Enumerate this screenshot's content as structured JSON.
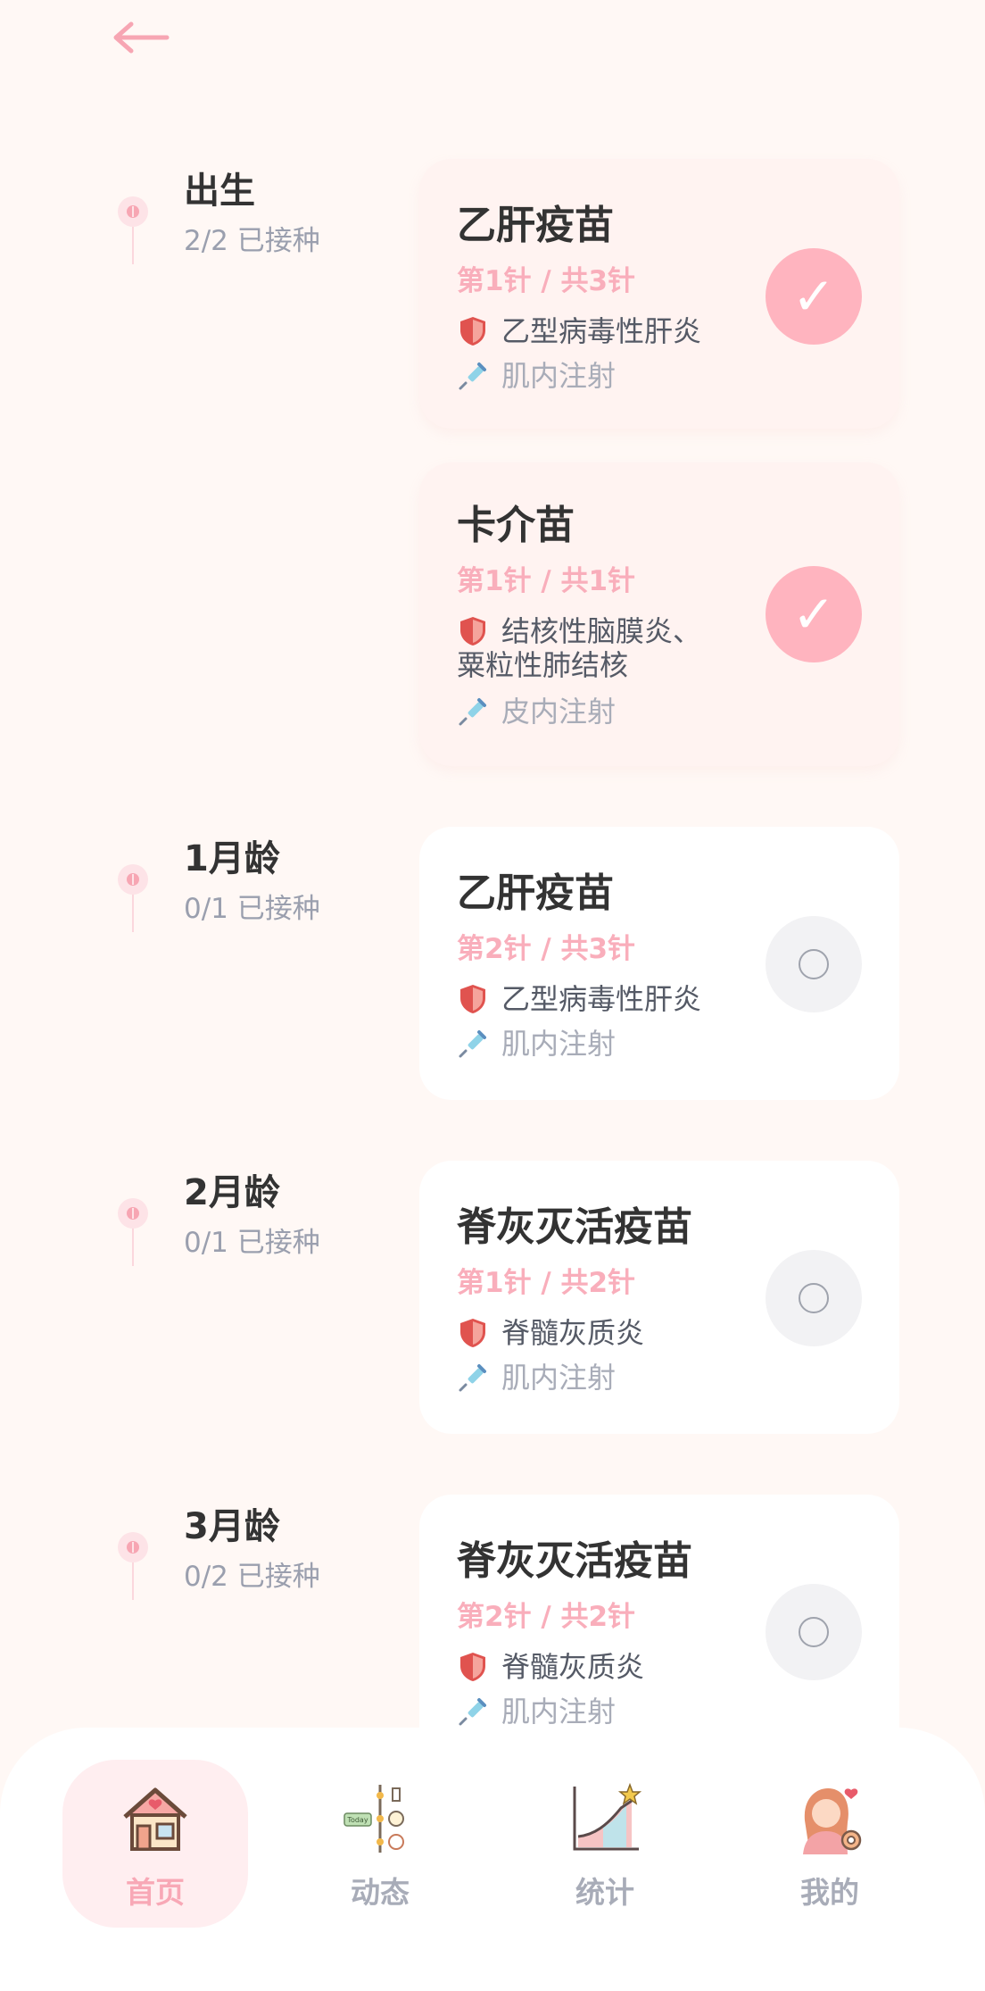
{
  "groups": [
    {
      "age": "出生",
      "progress": "2/2 已接种",
      "vaccines": [
        {
          "name": "乙肝疫苗",
          "dose": "第1针 / 共3针",
          "disease": "乙型病毒性肝炎",
          "route": "肌内注射",
          "done": true
        },
        {
          "name": "卡介苗",
          "dose": "第1针 / 共1针",
          "disease_line1": "结核性脑膜炎、",
          "disease_line2": "粟粒性肺结核",
          "route": "皮内注射",
          "done": true
        }
      ]
    },
    {
      "age": "1月龄",
      "progress": "0/1 已接种",
      "vaccines": [
        {
          "name": "乙肝疫苗",
          "dose": "第2针 / 共3针",
          "disease": "乙型病毒性肝炎",
          "route": "肌内注射",
          "done": false
        }
      ]
    },
    {
      "age": "2月龄",
      "progress": "0/1 已接种",
      "vaccines": [
        {
          "name": "脊灰灭活疫苗",
          "dose": "第1针 / 共2针",
          "disease": "脊髓灰质炎",
          "route": "肌内注射",
          "done": false
        }
      ]
    },
    {
      "age": "3月龄",
      "progress": "0/2 已接种",
      "vaccines": [
        {
          "name": "脊灰灭活疫苗",
          "dose": "第2针 / 共2针",
          "disease": "脊髓灰质炎",
          "route": "肌内注射",
          "done": false
        }
      ]
    }
  ],
  "status_glyphs": {
    "checked": "✓"
  },
  "tabs": [
    {
      "label": "首页",
      "icon": "house-icon",
      "active": true
    },
    {
      "label": "动态",
      "icon": "timeline-icon",
      "active": false
    },
    {
      "label": "统计",
      "icon": "growth-chart-icon",
      "active": false
    },
    {
      "label": "我的",
      "icon": "profile-settings-icon",
      "active": false
    }
  ],
  "colors": {
    "background": "#fff8f5",
    "accent_pink": "#ffb4bf",
    "dose_text": "#f9aebb",
    "done_card": "#fff3f1",
    "pending_card": "#ffffff"
  }
}
